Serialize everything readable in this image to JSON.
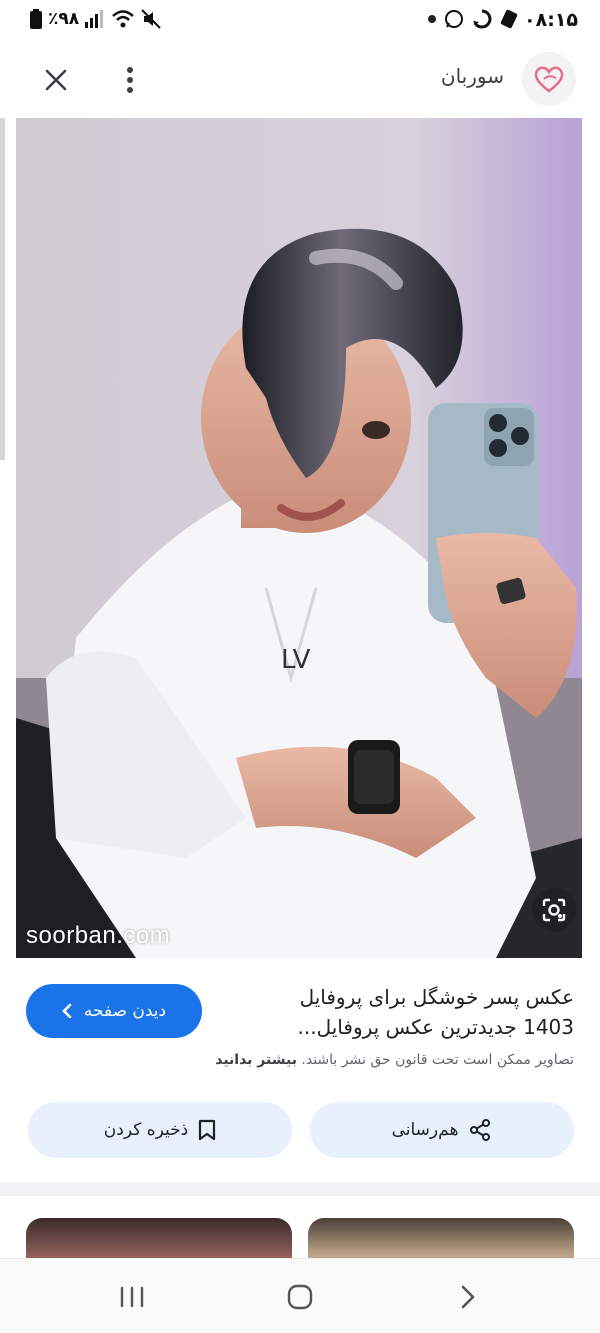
{
  "status_bar": {
    "time": "۰۸:۱۵",
    "battery_text": "٪۹۸",
    "icons": [
      "battery-icon",
      "signal-icon",
      "wifi-icon",
      "mute-icon",
      "whatsapp-icon",
      "sync-icon",
      "data-icon"
    ]
  },
  "header": {
    "site_name": "سوربان",
    "close_icon": "close-icon",
    "menu_icon": "more-vert-icon"
  },
  "image": {
    "watermark": "soorban.com",
    "lens_icon": "google-lens-icon"
  },
  "result": {
    "title": "عکس پسر خوشگل برای پروفایل 1403 جدیدترین عکس پروفایل...",
    "visit_label": "دیدن صفحه",
    "copyright_text": "تصاویر ممکن است تحت قانون حق نشر باشند.",
    "learn_more": "بیشتر بدانید",
    "share_label": "هم‌رسانی",
    "save_label": "ذخیره کردن"
  },
  "colors": {
    "accent": "#1a73e8",
    "pill_bg": "#e8f0fe",
    "brand_heart": "#e36d8a"
  }
}
